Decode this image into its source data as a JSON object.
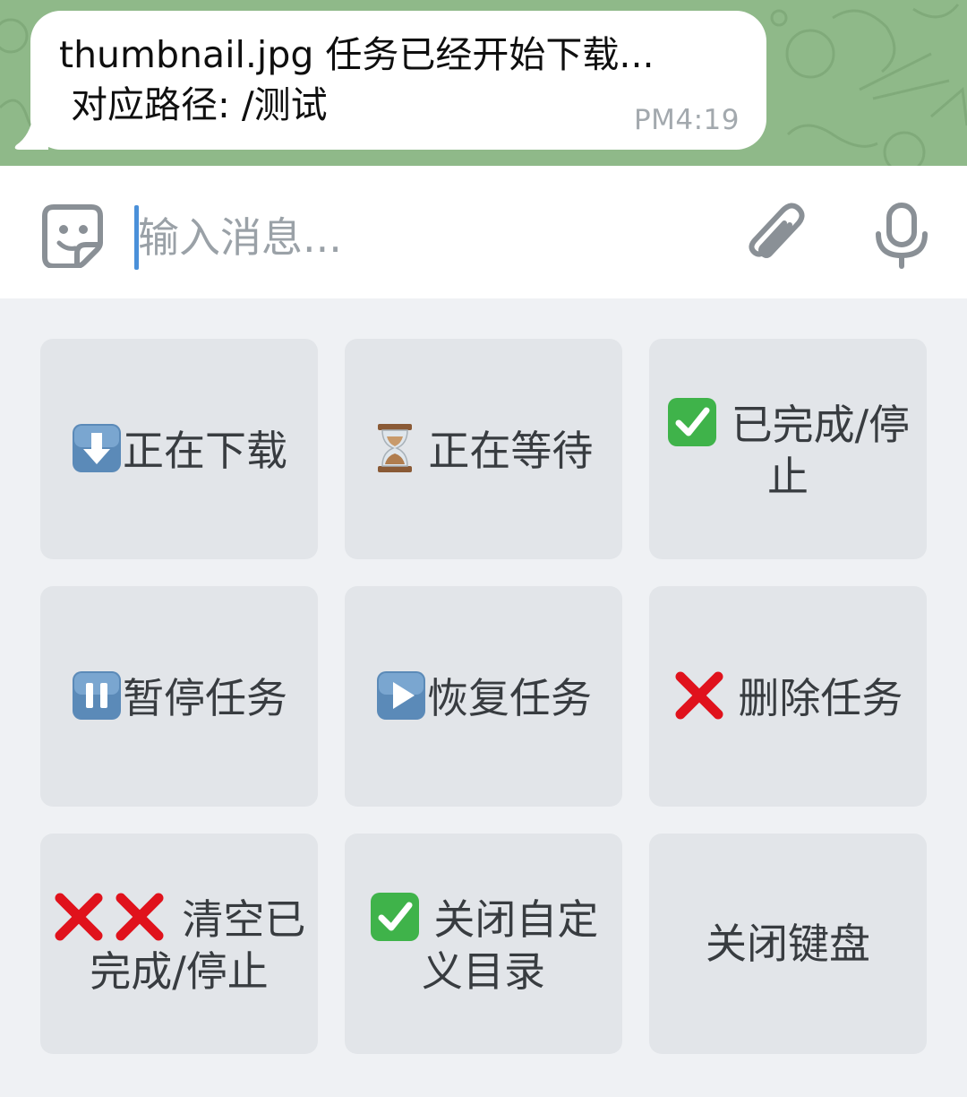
{
  "message": {
    "line1": "thumbnail.jpg 任务已经开始下载...",
    "line2": "对应路径: /测试",
    "time": "PM4:19"
  },
  "input": {
    "placeholder": "输入消息..."
  },
  "keyboard": {
    "buttons": [
      {
        "label": "正在下载",
        "icon": "down-arrow-icon"
      },
      {
        "label": "正在等待",
        "icon": "hourglass-icon"
      },
      {
        "label": "已完成/停止",
        "icon": "check-mark-icon"
      },
      {
        "label": "暂停任务",
        "icon": "pause-icon"
      },
      {
        "label": "恢复任务",
        "icon": "play-icon"
      },
      {
        "label": "删除任务",
        "icon": "cross-mark-icon"
      },
      {
        "label": "清空已完成/停止",
        "icon": "double-cross-mark-icon"
      },
      {
        "label": "关闭自定义目录",
        "icon": "check-mark-icon"
      },
      {
        "label": "关闭键盘",
        "icon": ""
      }
    ]
  },
  "colors": {
    "chat_background": "#8fb989",
    "input_background": "#ffffff",
    "keyboard_background": "#eff1f4",
    "button_background": "#e2e5e9",
    "caret": "#4a90d9",
    "emoji_blue": "#5b8ab8",
    "emoji_green": "#3fb34a",
    "emoji_red": "#e0121c"
  }
}
